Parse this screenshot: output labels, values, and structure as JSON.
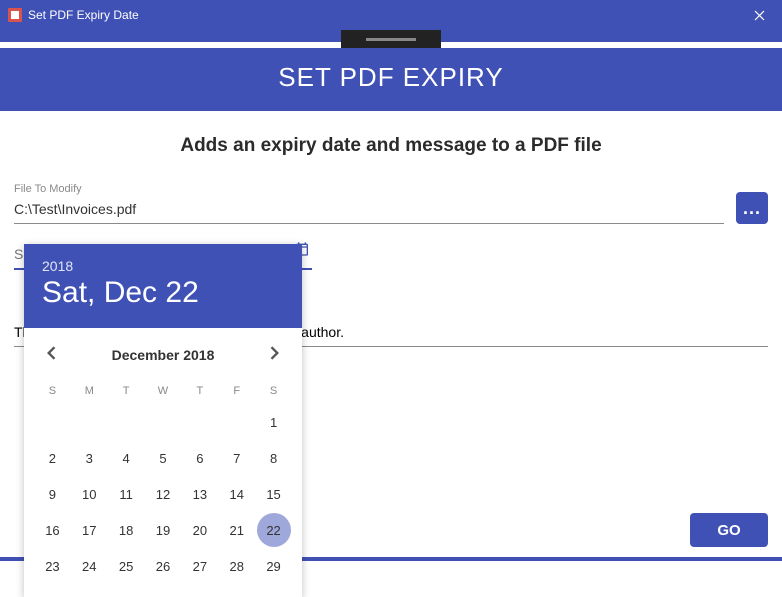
{
  "window": {
    "title": "Set PDF Expiry Date"
  },
  "header": {
    "app_title": "SET PDF EXPIRY"
  },
  "subtitle": "Adds an expiry date and message to a PDF file",
  "file": {
    "label": "File To Modify",
    "value": "C:\\Test\\Invoices.pdf",
    "browse": "..."
  },
  "expiry": {
    "label": "Select Expiry Date",
    "value": ""
  },
  "message": {
    "label": "",
    "value_prefix": "Th",
    "value_suffix": "e author."
  },
  "go": "GO",
  "datepicker": {
    "year": "2018",
    "headline": "Sat, Dec 22",
    "month_label": "December 2018",
    "dows": [
      "S",
      "M",
      "T",
      "W",
      "T",
      "F",
      "S"
    ],
    "leading_blanks": 6,
    "days": [
      "1",
      "2",
      "3",
      "4",
      "5",
      "6",
      "7",
      "8",
      "9",
      "10",
      "11",
      "12",
      "13",
      "14",
      "15",
      "16",
      "17",
      "18",
      "19",
      "20",
      "21",
      "22",
      "23",
      "24",
      "25",
      "26",
      "27",
      "28",
      "29"
    ],
    "selected": "22"
  }
}
